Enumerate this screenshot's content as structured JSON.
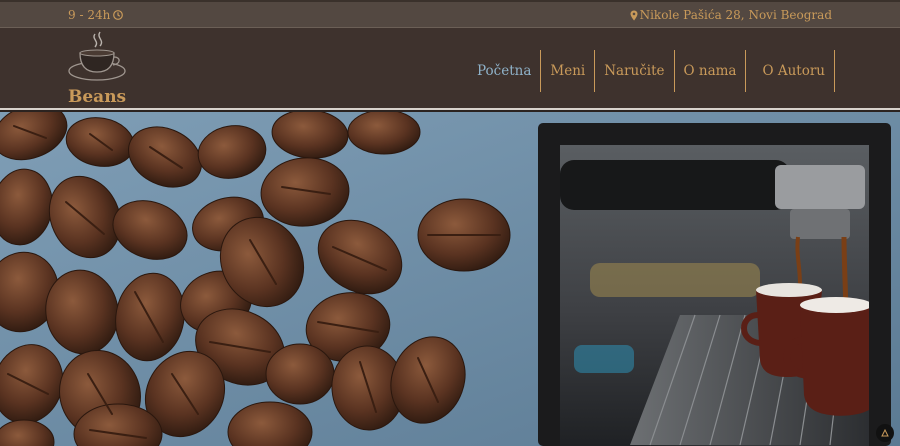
{
  "topbar": {
    "hours": "9 - 24h",
    "address": "Nikole Pašića 28, Novi Beograd"
  },
  "brand": {
    "name": "Beans"
  },
  "nav": {
    "items": [
      {
        "label": "Početna",
        "active": true
      },
      {
        "label": "Meni"
      },
      {
        "label": "Naručite"
      },
      {
        "label": "O nama"
      },
      {
        "label": "O Autoru"
      }
    ]
  },
  "colors": {
    "accent": "#c99a5a",
    "active_link": "#8fb2c9",
    "header_bg": "#3e322d",
    "topbar_bg": "#534841"
  },
  "icons": [
    "clock-icon",
    "map-pin-icon",
    "coffee-cup-logo-icon",
    "scroll-to-top-icon"
  ]
}
